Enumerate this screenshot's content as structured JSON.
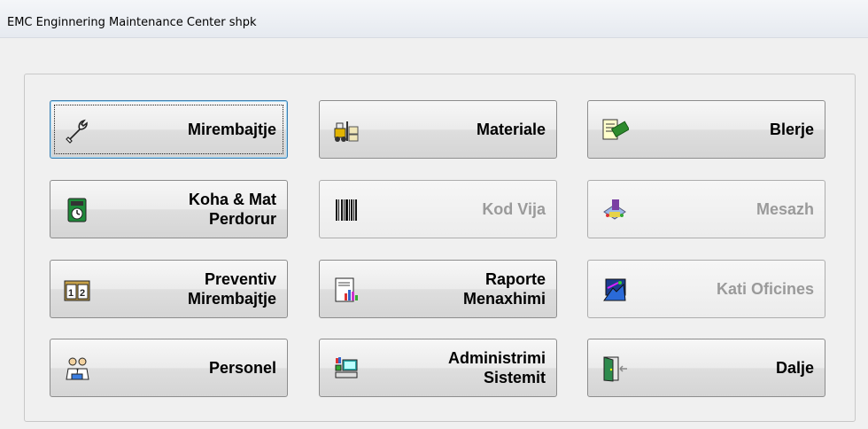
{
  "window": {
    "title": "EMC Enginnering Maintenance Center shpk"
  },
  "buttons": [
    {
      "label": "Mirembajtje",
      "icon": "wrench-icon",
      "enabled": true,
      "focused": true
    },
    {
      "label": "Materiale",
      "icon": "forklift-icon",
      "enabled": true
    },
    {
      "label": "Blerje",
      "icon": "purchase-icon",
      "enabled": true
    },
    {
      "label": "Koha & Mat\nPerdorur",
      "icon": "clock-icon",
      "enabled": true
    },
    {
      "label": "Kod Vija",
      "icon": "barcode-icon",
      "enabled": false
    },
    {
      "label": "Mesazh",
      "icon": "message-icon",
      "enabled": false
    },
    {
      "label": "Preventiv\nMirembajtje",
      "icon": "calendar-icon",
      "enabled": true
    },
    {
      "label": "Raporte\nMenaxhimi",
      "icon": "report-icon",
      "enabled": true
    },
    {
      "label": "Kati Oficines",
      "icon": "office-floor-icon",
      "enabled": false
    },
    {
      "label": "Personel",
      "icon": "people-icon",
      "enabled": true
    },
    {
      "label": "Administrimi\nSistemit",
      "icon": "computer-icon",
      "enabled": true
    },
    {
      "label": "Dalje",
      "icon": "exit-door-icon",
      "enabled": true
    }
  ]
}
